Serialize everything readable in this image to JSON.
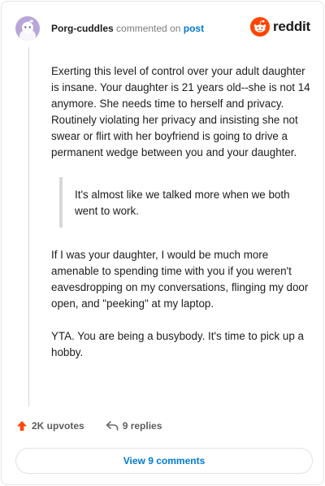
{
  "header": {
    "username": "Porg-cuddles",
    "action_text": "commented on",
    "post_link": "post",
    "logo_text": "reddit",
    "avatar_icon": "snoo-avatar-icon",
    "logo_icon": "reddit-alien-icon"
  },
  "comment": {
    "paragraphs": [
      "Exerting this level of control over your adult daughter is insane. Your daughter is 21 years old--she is not 14 anymore. She needs time to herself and privacy. Routinely violating her privacy and insisting she not swear or flirt with her boyfriend is going to drive a permanent wedge between you and your daughter.",
      "If I was your daughter, I would be much more amenable to spending time with you if you weren't eavesdropping on my conversations, flinging my door open, and \"peeking\" at my laptop.",
      "YTA. You are being a busybody. It's time to pick up a hobby."
    ],
    "quote": "It's almost like we talked more when we both went to work."
  },
  "actions": {
    "upvotes": "2K upvotes",
    "replies": "9 replies",
    "upvote_icon": "upvote-arrow-icon",
    "reply_icon": "reply-arrow-icon"
  },
  "footer": {
    "view_button": "View 9 comments"
  },
  "colors": {
    "accent": "#0079d3",
    "upvote": "#ff4500",
    "avatar_bg": "#b8a6d9"
  }
}
